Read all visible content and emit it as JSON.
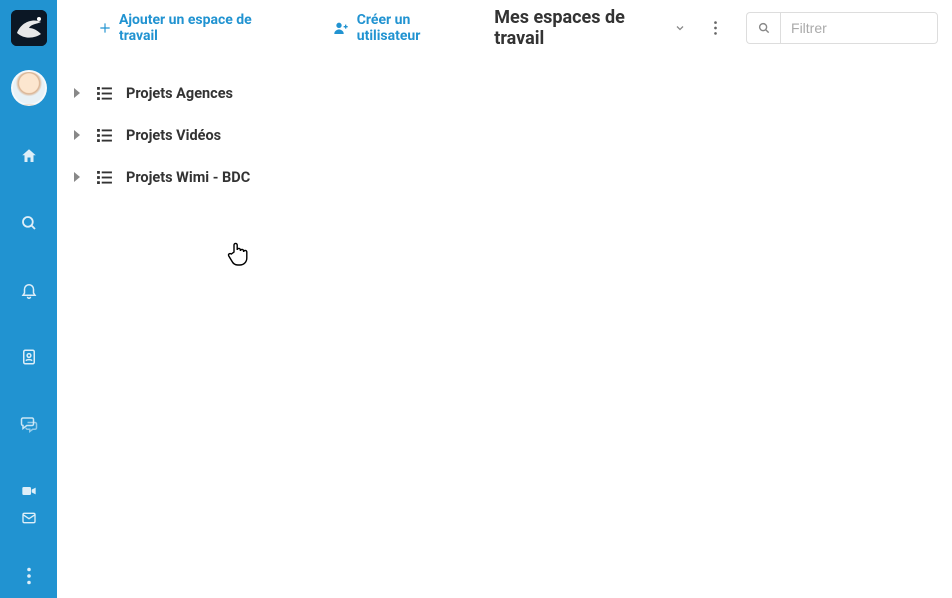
{
  "sidebar": {
    "logo_name": "app-logo",
    "icons": [
      "home-icon",
      "search-icon",
      "bell-icon",
      "contacts-icon",
      "chat-icon",
      "video-icon"
    ],
    "bottom_icons": [
      "mail-icon",
      "more-vertical-icon"
    ]
  },
  "header": {
    "add_workspace": "Ajouter un espace de travail",
    "create_user": "Créer un utilisateur",
    "dropdown_label": "Mes espaces de travail",
    "search_placeholder": "Filtrer"
  },
  "tree": {
    "items": [
      {
        "label": "Projets Agences"
      },
      {
        "label": "Projets Vidéos"
      },
      {
        "label": "Projets Wimi - BDC"
      }
    ]
  },
  "colors": {
    "accent": "#2193d1"
  }
}
